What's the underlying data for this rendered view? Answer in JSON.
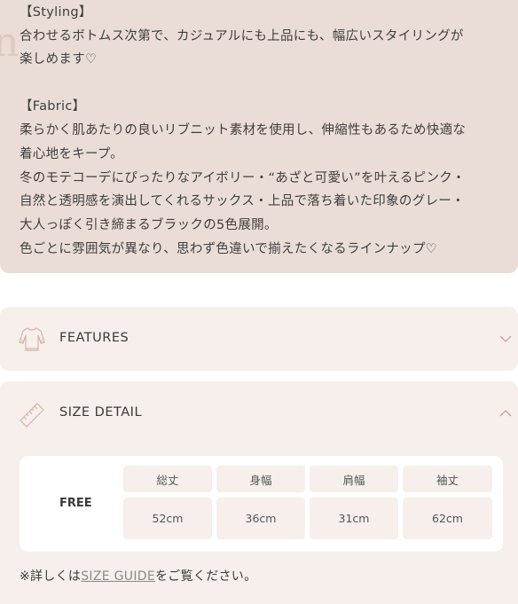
{
  "description": {
    "deco_letter": "n",
    "lines": [
      "【Styling】",
      "合わせるボトムス次第で、カジュアルにも上品にも、幅広いスタイリングが",
      "楽しめます♡",
      "",
      "【Fabric】",
      "柔らかく肌あたりの良いリブニット素材を使用し、伸縮性もあるため快適な",
      "着心地をキープ。",
      "冬のモテコーデにぴったりなアイボリー・“あざと可愛い”を叶えるピンク・",
      "自然と透明感を演出してくれるサックス・上品で落ち着いた印象のグレー・",
      "大人っぽく引き締まるブラックの5色展開。",
      "色ごとに雰囲気が異なり、思わず色違いで揃えたくなるラインナップ♡"
    ]
  },
  "features": {
    "title": "FEATURES",
    "icon": "sweater-icon",
    "expanded": false
  },
  "size_detail": {
    "title": "SIZE DETAIL",
    "icon": "ruler-icon",
    "expanded": true,
    "size_label": "FREE",
    "headers": [
      "総丈",
      "身幅",
      "肩幅",
      "袖丈"
    ],
    "values": [
      "52cm",
      "36cm",
      "31cm",
      "62cm"
    ],
    "note_prefix": "※詳しくは",
    "note_link": "SIZE GUIDE",
    "note_suffix": "をご覧ください。"
  },
  "colors": {
    "desc_bg": "#eaddd7",
    "accordion_bg": "#f6efec",
    "icon_stroke": "#d4b4a6"
  }
}
